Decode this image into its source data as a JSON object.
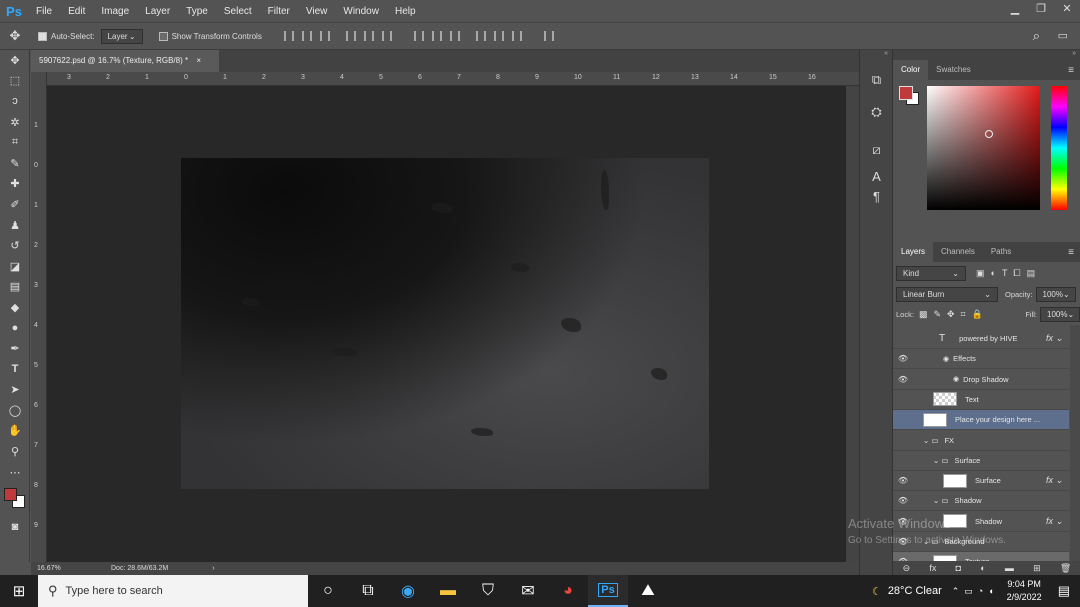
{
  "app": {
    "logo": "Ps",
    "menu": [
      "File",
      "Edit",
      "Image",
      "Layer",
      "Type",
      "Select",
      "Filter",
      "View",
      "Window",
      "Help"
    ]
  },
  "window_controls": {
    "minimize": "▁",
    "restore": "❐",
    "close": "✕"
  },
  "options": {
    "auto_select_label": "Auto-Select:",
    "auto_select_value": "Layer",
    "transform_label": "Show Transform Controls"
  },
  "document": {
    "tab_title": "5907622.psd @ 16.7% (Texture, RGB/8) *",
    "close": "×",
    "zoom": "16.67%",
    "doc_info": "Doc: 28.6M/63.2M"
  },
  "ruler": {
    "h": [
      "3",
      "2",
      "1",
      "0",
      "1",
      "2",
      "3",
      "4",
      "5",
      "6",
      "7",
      "8",
      "9",
      "10",
      "11",
      "12",
      "13",
      "14",
      "15",
      "16"
    ],
    "v": [
      "1",
      "0",
      "1",
      "2",
      "3",
      "4",
      "5",
      "6",
      "7",
      "8",
      "9"
    ]
  },
  "color_panel": {
    "tabs": [
      "Color",
      "Swatches"
    ],
    "fg": "#c0393b",
    "bg": "#ffffff"
  },
  "layers_panel": {
    "tabs": [
      "Layers",
      "Channels",
      "Paths"
    ],
    "kind_label": "Kind",
    "blend_mode": "Linear Burn",
    "opacity_label": "Opacity:",
    "opacity": "100%",
    "lock_label": "Lock:",
    "fill_label": "Fill:",
    "fill": "100%",
    "layers": [
      {
        "name": "powered by HIVE",
        "indent": 2,
        "type": "text",
        "fx": true,
        "visible": false
      },
      {
        "name": "Effects",
        "indent": 3,
        "type": "effect",
        "visible": true
      },
      {
        "name": "Drop Shadow",
        "indent": 4,
        "type": "effect",
        "visible": true
      },
      {
        "name": "Text",
        "indent": 2,
        "type": "raster",
        "visible": false
      },
      {
        "name": "Place your design here ...",
        "indent": 1,
        "type": "smart",
        "visible": false,
        "selected": true
      },
      {
        "name": "FX",
        "indent": 1,
        "type": "group",
        "visible": false
      },
      {
        "name": "Surface",
        "indent": 2,
        "type": "group",
        "visible": false
      },
      {
        "name": "Surface",
        "indent": 3,
        "type": "smart",
        "fx": true,
        "visible": true
      },
      {
        "name": "Shadow",
        "indent": 2,
        "type": "group",
        "visible": true
      },
      {
        "name": "Shadow",
        "indent": 3,
        "type": "smart",
        "fx": true,
        "visible": true
      },
      {
        "name": "Background",
        "indent": 1,
        "type": "group",
        "visible": true
      },
      {
        "name": "Texture",
        "indent": 2,
        "type": "smart",
        "visible": true,
        "highlight": true
      }
    ]
  },
  "watermark": {
    "line1": "Activate Windows",
    "line2": "Go to Settings to activate Windows."
  },
  "taskbar": {
    "search_placeholder": "Type here to search",
    "weather": "28°C  Clear",
    "time": "9:04 PM",
    "date": "2/9/2022"
  }
}
